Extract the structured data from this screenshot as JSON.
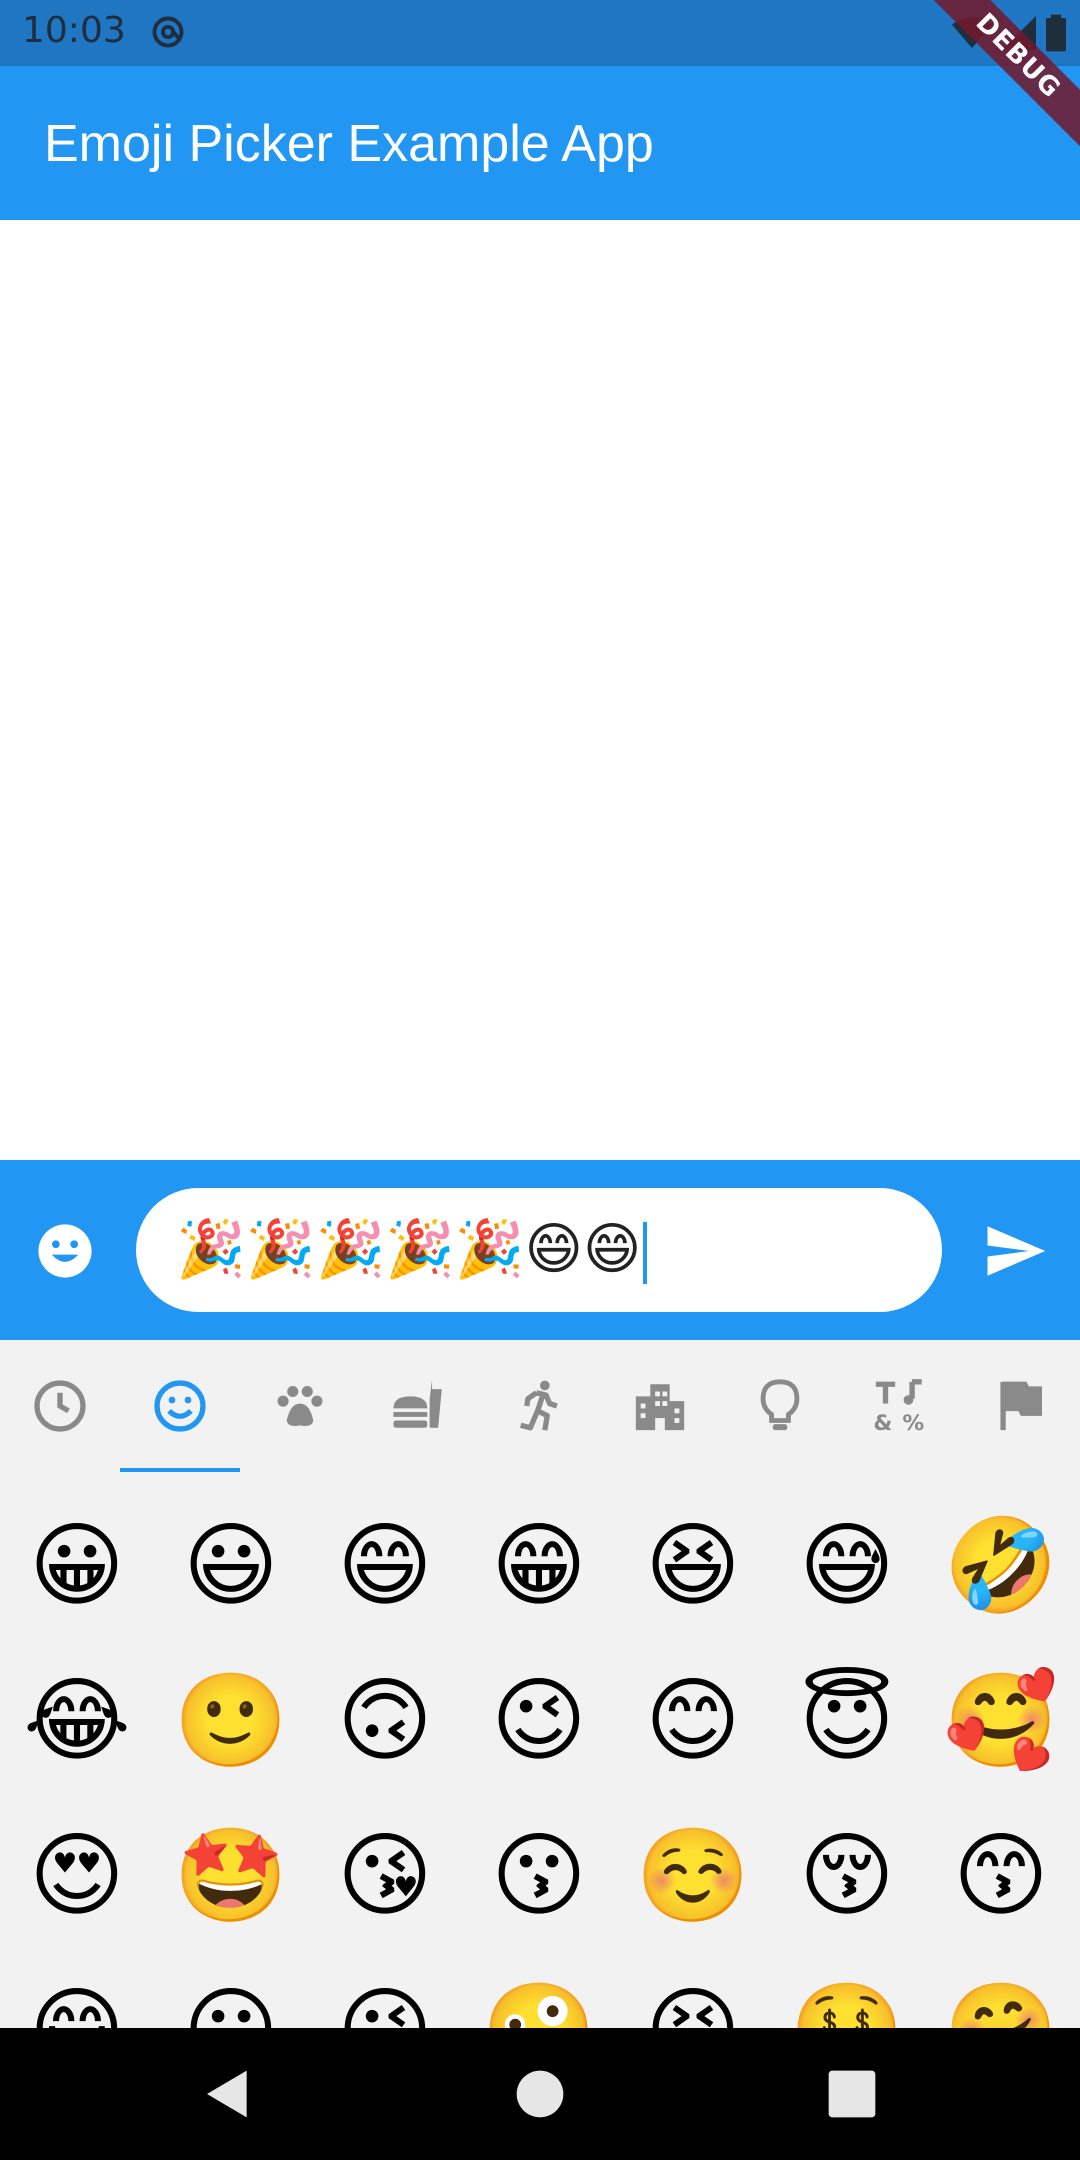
{
  "status_bar": {
    "time": "10:03",
    "icons": [
      "at-sign-icon",
      "wifi-icon",
      "signal-icon",
      "battery-icon"
    ]
  },
  "debug_banner": "DEBUG",
  "app_bar": {
    "title": "Emoji Picker Example App",
    "color": "#2196f3"
  },
  "input_bar": {
    "text": "🎉🎉🎉🎉🎉😄😄",
    "emoji_button_icon": "smiley-face-icon",
    "send_button_icon": "send-icon"
  },
  "picker": {
    "categories": [
      {
        "icon": "clock-icon",
        "name": "recent"
      },
      {
        "icon": "smiley-icon",
        "name": "smileys",
        "selected": true
      },
      {
        "icon": "paw-icon",
        "name": "animals"
      },
      {
        "icon": "food-icon",
        "name": "food"
      },
      {
        "icon": "runner-icon",
        "name": "activities"
      },
      {
        "icon": "building-icon",
        "name": "travel"
      },
      {
        "icon": "lightbulb-icon",
        "name": "objects"
      },
      {
        "icon": "symbols-icon",
        "name": "symbols"
      },
      {
        "icon": "flag-icon",
        "name": "flags"
      }
    ],
    "accent_color": "#2196f3",
    "emojis": [
      "😀",
      "😃",
      "😄",
      "😁",
      "😆",
      "😅",
      "🤣",
      "😂",
      "🙂",
      "🙃",
      "😉",
      "😊",
      "😇",
      "🥰",
      "😍",
      "🤩",
      "😘",
      "😗",
      "☺️",
      "😚",
      "😙",
      "😋",
      "😛",
      "😜",
      "🤪",
      "😝",
      "🤑",
      "🤗"
    ]
  },
  "nav_bar": {
    "icons": [
      "back-icon",
      "home-icon",
      "recents-icon"
    ]
  }
}
